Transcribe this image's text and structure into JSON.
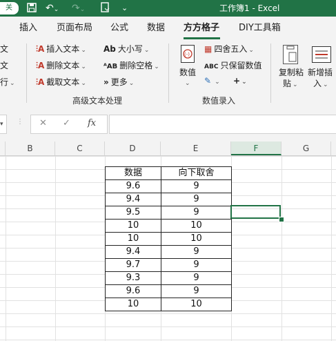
{
  "window": {
    "title": "工作簿1  -  Excel",
    "autosave_toggle": "关",
    "accent": "#217346"
  },
  "quick_access": [
    "save-icon",
    "undo-icon",
    "redo-icon",
    "touch-mode-icon",
    "customize-icon"
  ],
  "tabs": [
    {
      "label": "插入"
    },
    {
      "label": "页面布局"
    },
    {
      "label": "公式"
    },
    {
      "label": "数据"
    },
    {
      "label": "方方格子",
      "active": true
    },
    {
      "label": "DIY工具箱"
    }
  ],
  "ribbon": {
    "left_partial": [
      "文",
      "文",
      "行"
    ],
    "text_group": {
      "insert_text": "插入文本",
      "delete_text": "删除文本",
      "extract_text": "截取文本",
      "case": "大小写",
      "delete_spaces": "删除空格",
      "more": "更多",
      "label": "高级文本处理"
    },
    "number_group": {
      "value": "数值",
      "round": "四舍五入",
      "keep_value": "只保留数值",
      "label": "数值录入"
    },
    "paste_group": {
      "copy_paste_1": "复制粘",
      "copy_paste_2": "贴",
      "insert_1": "新增插",
      "insert_2": "入"
    }
  },
  "formula_bar": {
    "cancel": "✕",
    "enter": "✓",
    "fx": "fx",
    "value": ""
  },
  "columns": [
    "B",
    "C",
    "D",
    "E",
    "F",
    "G"
  ],
  "selected_column": "F",
  "table": {
    "headers": [
      "数据",
      "向下取舍"
    ],
    "rows": [
      [
        "9.6",
        "9"
      ],
      [
        "9.4",
        "9"
      ],
      [
        "9.5",
        "9"
      ],
      [
        "10",
        "10"
      ],
      [
        "10",
        "10"
      ],
      [
        "9.4",
        "9"
      ],
      [
        "9.7",
        "9"
      ],
      [
        "9.3",
        "9"
      ],
      [
        "9.6",
        "9"
      ],
      [
        "10",
        "10"
      ]
    ]
  }
}
